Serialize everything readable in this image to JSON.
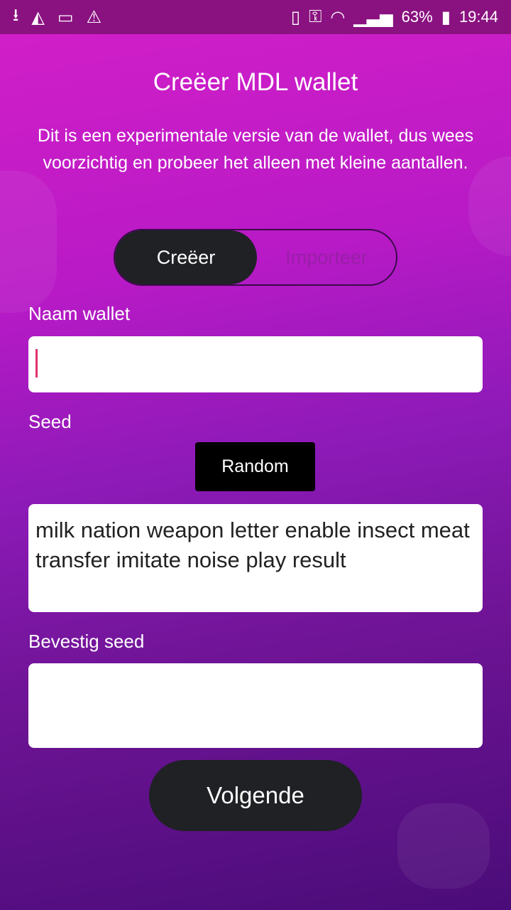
{
  "status": {
    "battery": "63%",
    "time": "19:44"
  },
  "title": "Creëer MDL wallet",
  "description": "Dit is een experimentale versie van de wallet, dus wees voorzichtig en probeer het alleen met kleine aantallen.",
  "toggle": {
    "create": "Creëer",
    "import": "Importeer"
  },
  "form": {
    "name_label": "Naam wallet",
    "name_value": "",
    "seed_label": "Seed",
    "random_label": "Random",
    "seed_value": "milk nation weapon letter enable insect meat transfer imitate noise play result",
    "confirm_label": "Bevestig seed",
    "confirm_value": ""
  },
  "next_label": "Volgende"
}
